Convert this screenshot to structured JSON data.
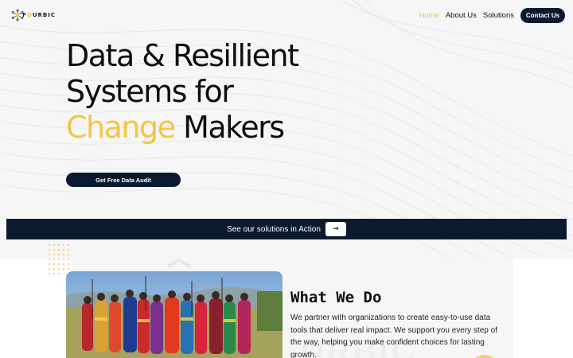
{
  "brand": {
    "logo_prefix": "F",
    "logo_o": "O",
    "logo_suffix": "URBIC"
  },
  "nav": {
    "items": [
      {
        "label": "Home",
        "active": true
      },
      {
        "label": "About Us",
        "active": false
      },
      {
        "label": "Solutions",
        "active": false
      }
    ],
    "contact_label": "Contact Us"
  },
  "hero": {
    "line1": "Data & Resillient",
    "line2": "Systems for",
    "accent": "Change",
    "line3_rest": " Makers",
    "cta_label": "Get Free Data Audit"
  },
  "band": {
    "text": "See our solutions in Action",
    "button_icon": "→"
  },
  "what_we_do": {
    "title": "What We Do",
    "body": "We partner with organizations to create easy-to-use data tools that deliver real impact. We support you every step of the way, helping you make confident choices for lasting growth.",
    "ghost": "URBIC"
  },
  "colors": {
    "accent": "#f5c542",
    "navy": "#0b1a2e"
  }
}
